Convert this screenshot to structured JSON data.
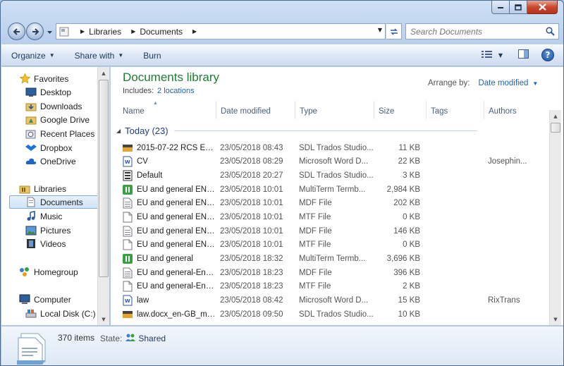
{
  "window": {
    "minimize": "minimize",
    "maximize": "maximize",
    "close": "close"
  },
  "address": {
    "segments": [
      "Libraries",
      "Documents"
    ]
  },
  "search": {
    "placeholder": "Search Documents"
  },
  "toolbar": {
    "organize": "Organize",
    "share_with": "Share with",
    "burn": "Burn",
    "help": "?"
  },
  "nav": {
    "favorites": {
      "label": "Favorites",
      "items": [
        "Desktop",
        "Downloads",
        "Google Drive",
        "Recent Places",
        "Dropbox",
        "OneDrive"
      ]
    },
    "libraries": {
      "label": "Libraries",
      "items": [
        "Documents",
        "Music",
        "Pictures",
        "Videos"
      ],
      "selected": "Documents"
    },
    "homegroup": {
      "label": "Homegroup"
    },
    "computer": {
      "label": "Computer",
      "items": [
        "Local Disk (C:)"
      ]
    }
  },
  "library": {
    "title": "Documents library",
    "includes_label": "Includes:",
    "includes_link": "2 locations",
    "arrange_label": "Arrange by:",
    "arrange_value": "Date modified"
  },
  "columns": [
    "Name",
    "Date modified",
    "Type",
    "Size",
    "Tags",
    "Authors"
  ],
  "group": {
    "label": "Today (23)"
  },
  "files": [
    {
      "name": "2015-07-22 RCS Extr...",
      "date": "23/05/2018 08:43",
      "type": "SDL Trados Studio...",
      "size": "11 KB",
      "author": "",
      "icon": "trados-icon"
    },
    {
      "name": "CV",
      "date": "23/05/2018 08:29",
      "type": "Microsoft Word D...",
      "size": "22 KB",
      "author": "Josephin...",
      "icon": "word-doc-icon"
    },
    {
      "name": "Default",
      "date": "23/05/2018 20:27",
      "type": "SDL Trados Studio...",
      "size": "3 KB",
      "author": "",
      "icon": "settings-file-icon"
    },
    {
      "name": "EU and general EN-...",
      "date": "23/05/2018 10:01",
      "type": "MultiTerm Termb...",
      "size": "2,984 KB",
      "author": "",
      "icon": "multiterm-icon"
    },
    {
      "name": "EU and general EN-...",
      "date": "23/05/2018 10:01",
      "type": "MDF File",
      "size": "202 KB",
      "author": "",
      "icon": "mdf-file-icon"
    },
    {
      "name": "EU and general EN-...",
      "date": "23/05/2018 10:01",
      "type": "MTF File",
      "size": "0 KB",
      "author": "",
      "icon": "blank-file-icon"
    },
    {
      "name": "EU and general EN-...",
      "date": "23/05/2018 10:01",
      "type": "MDF File",
      "size": "146 KB",
      "author": "",
      "icon": "mdf-file-icon"
    },
    {
      "name": "EU and general EN-...",
      "date": "23/05/2018 10:01",
      "type": "MTF File",
      "size": "0 KB",
      "author": "",
      "icon": "blank-file-icon"
    },
    {
      "name": "EU and general",
      "date": "23/05/2018 18:32",
      "type": "MultiTerm Termb...",
      "size": "3,696 KB",
      "author": "",
      "icon": "multiterm-icon"
    },
    {
      "name": "EU and general-Eng...",
      "date": "23/05/2018 18:23",
      "type": "MDF File",
      "size": "396 KB",
      "author": "",
      "icon": "mdf-file-icon"
    },
    {
      "name": "EU and general-Eng...",
      "date": "23/05/2018 18:23",
      "type": "MTF File",
      "size": "2 KB",
      "author": "",
      "icon": "blank-file-icon"
    },
    {
      "name": "law",
      "date": "23/05/2018 08:42",
      "type": "Microsoft Word D...",
      "size": "15 KB",
      "author": "RixTrans",
      "icon": "word-doc-icon"
    },
    {
      "name": "law.docx_en-GB_mt...",
      "date": "23/05/2018 09:50",
      "type": "SDL Trados Studio...",
      "size": "10 KB",
      "author": "",
      "icon": "trados-icon"
    }
  ],
  "details": {
    "count": "370 items",
    "state_label": "State:",
    "state_value": "Shared"
  }
}
